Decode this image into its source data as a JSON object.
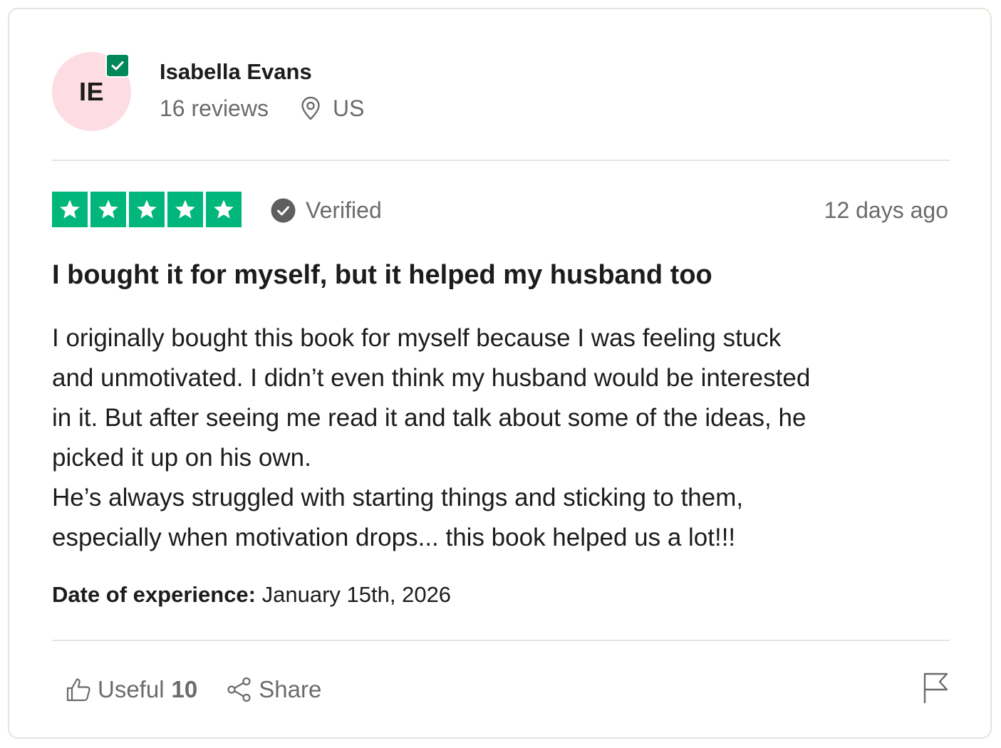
{
  "reviewer": {
    "initials": "IE",
    "name": "Isabella Evans",
    "reviews_count": "16 reviews",
    "country": "US",
    "avatar_color": "#fddce3",
    "badge_color": "#00875a"
  },
  "review": {
    "rating": 5,
    "rating_max": 5,
    "star_color": "#00b67a",
    "verified_label": "Verified",
    "posted": "12 days ago",
    "title": "I bought it for myself, but it helped my husband too",
    "body_lines": [
      "I originally bought this book for myself because I was feeling stuck",
      "and unmotivated. I didn’t even think my husband would be interested",
      "in it. But after seeing me read it and talk about some of the ideas, he",
      "picked it up on his own.",
      "He’s always struggled with starting things and sticking to them,",
      "especially when motivation drops... this book helped us a lot!!!"
    ],
    "experience_label": "Date of experience:",
    "experience_date": "January 15th, 2026"
  },
  "actions": {
    "useful_label": "Useful",
    "useful_count": "10",
    "share_label": "Share"
  },
  "icons": {
    "badge": "verified-check-icon",
    "location": "location-pin-icon",
    "verified": "check-circle-icon",
    "useful": "thumbs-up-icon",
    "share": "share-icon",
    "report": "flag-icon"
  }
}
